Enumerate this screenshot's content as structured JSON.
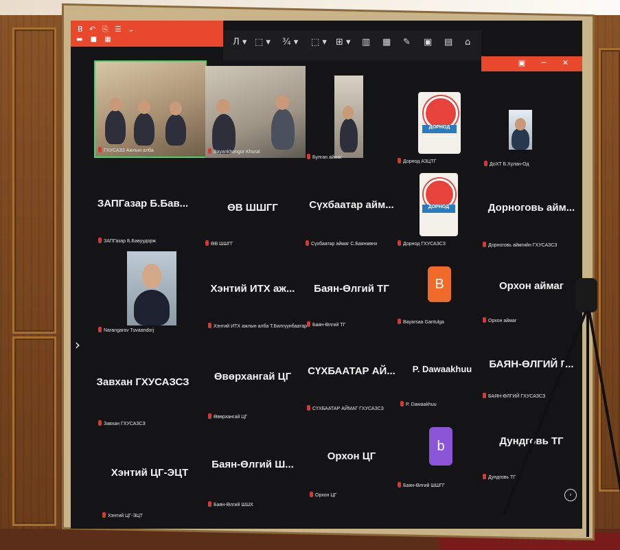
{
  "toolbar": {
    "qat_icons": "B ↶ ⎘ ☰ ⌄",
    "qat_row2": "▬ ■ ▦",
    "tools": [
      "Л ▾",
      "⬚ ▾",
      "¾ ▾",
      "⬚ ▾",
      "⊞ ▾",
      "▥",
      "▦",
      "✎",
      "▣",
      "▤",
      "⌂"
    ],
    "window_buttons": "▣ ─ ✕"
  },
  "tiles": [
    {
      "name": "",
      "label": "ГХУСАЗЗ Ажлын алба",
      "type": "video"
    },
    {
      "name": "",
      "label": "Bayankhongor Khural",
      "type": "video"
    },
    {
      "name": "",
      "label": "Булган аймаг",
      "type": "video"
    },
    {
      "name": "",
      "label": "Дорнод АЗЦТГ",
      "type": "logo",
      "logo_text": "ДОРНОД"
    },
    {
      "name": "",
      "label": "ДоХТ Б.Хулан-Од",
      "type": "video"
    },
    {
      "name": "ЗАПГазар Б.Бав...",
      "label": "ЗАПГазар Б.Бавуудорж"
    },
    {
      "name": "ӨВ ШШГГ",
      "label": "ӨВ ШШГГ"
    },
    {
      "name": "Сүхбаатар айм...",
      "label": "Сүхбаатар аймаг С.Баянмөнх"
    },
    {
      "name": "",
      "label": "Дорнод ГХУСАЗСЗ",
      "type": "logo",
      "logo_text": "ДОРНОД"
    },
    {
      "name": "Дорноговь айм...",
      "label": "Дорноговь аймгийн ГХУСАЗСЗ"
    },
    {
      "name": "",
      "label": "Narangarav Tuvaandorj",
      "type": "photo"
    },
    {
      "name": "Хэнтий ИТХ аж...",
      "label": "Хэнтий ИТХ ажлын алба Т.Билгүүнбаатар"
    },
    {
      "name": "Баян-Өлгий ТГ",
      "label": "Баян-Өлгий ТГ"
    },
    {
      "name": "",
      "label": "Bayarsaa Gantulga",
      "type": "letter",
      "letter": "B",
      "color": "#f06a2a"
    },
    {
      "name": "Орхон аймаг",
      "label": "Орхон аймаг"
    },
    {
      "name": "Завхан ГХУСАЗСЗ",
      "label": "Завхан ГХУСАЗСЗ"
    },
    {
      "name": "Өвөрхангай ЦГ",
      "label": "Өвөрхангай ЦГ"
    },
    {
      "name": "СҮХБААТАР АЙ...",
      "label": "СҮХБААТАР АЙМАГ ГХУСАЗСЗ"
    },
    {
      "name": "P. Dawaakhuu",
      "label": "P. Dawaakhuu"
    },
    {
      "name": "БАЯН-ӨЛГИЙ Г...",
      "label": "БАЯН-ӨЛГИЙ ГХУСАЗСЗ"
    },
    {
      "name": "Хэнтий ЦГ-ЭЦТ",
      "label": "Хэнтий ЦГ-ЭЦТ"
    },
    {
      "name": "Баян-Өлгий Ш...",
      "label": "Баян-Өлгий ШШХ"
    },
    {
      "name": "Орхон ЦГ",
      "label": "Орхон ЦГ"
    },
    {
      "name": "",
      "label": "Баян-Өлгий ШШГГ",
      "type": "letter",
      "letter": "b",
      "color": "#8a55d6"
    },
    {
      "name": "Дундговь ТГ",
      "label": "Дундговь ТГ"
    }
  ],
  "nav": {
    "side_arrow": "›",
    "corner": "›"
  }
}
